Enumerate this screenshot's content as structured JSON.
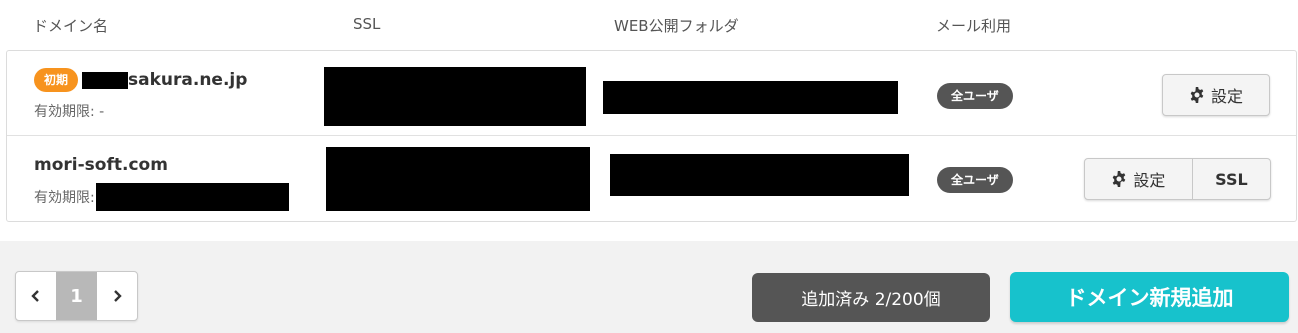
{
  "columns": {
    "domain": "ドメイン名",
    "ssl": "SSL",
    "web_folder": "WEB公開フォルダ",
    "mail": "メール利用"
  },
  "rows": [
    {
      "badge": "初期",
      "domain_suffix": "sakura.ne.jp",
      "expiry_label": "有効期限: -",
      "mail_usage": "全ユーザ",
      "settings_label": "設定"
    },
    {
      "domain": "mori-soft.com",
      "expiry_label": "有効期限:",
      "mail_usage": "全ユーザ",
      "settings_label": "設定",
      "ssl_label": "SSL"
    }
  ],
  "pagination": {
    "prev_icon": "chevron-left-icon",
    "current_page": "1",
    "next_icon": "chevron-right-icon"
  },
  "usage_count": "追加済み 2/200個",
  "add_domain_label": "ドメイン新規追加",
  "colors": {
    "accent": "#17c2cc",
    "badge_orange": "#f7931e",
    "dark_pill": "#555555"
  },
  "icons": {
    "settings": "gear-icon"
  }
}
